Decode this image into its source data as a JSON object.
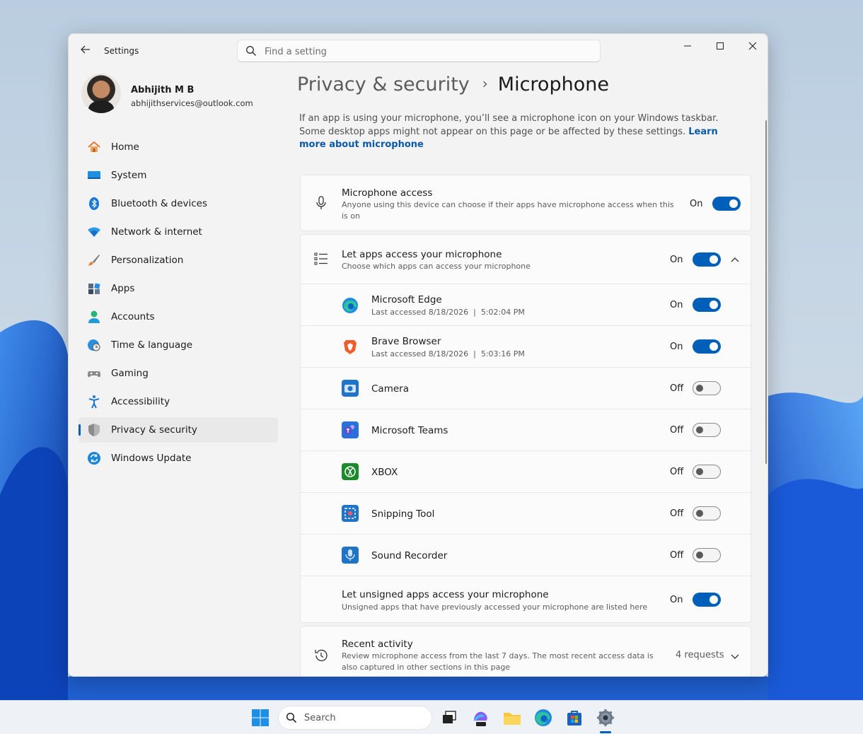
{
  "window": {
    "app_title": "Settings"
  },
  "search": {
    "placeholder": "Find a setting"
  },
  "profile": {
    "name": "Abhijith M B",
    "email": "abhijithservices@outlook.com"
  },
  "sidebar": {
    "items": [
      {
        "label": "Home",
        "icon": "home-icon"
      },
      {
        "label": "System",
        "icon": "system-icon"
      },
      {
        "label": "Bluetooth & devices",
        "icon": "bluetooth-icon"
      },
      {
        "label": "Network & internet",
        "icon": "wifi-icon"
      },
      {
        "label": "Personalization",
        "icon": "brush-icon"
      },
      {
        "label": "Apps",
        "icon": "apps-icon"
      },
      {
        "label": "Accounts",
        "icon": "accounts-icon"
      },
      {
        "label": "Time & language",
        "icon": "globe-clock-icon"
      },
      {
        "label": "Gaming",
        "icon": "controller-icon"
      },
      {
        "label": "Accessibility",
        "icon": "accessibility-icon"
      },
      {
        "label": "Privacy & security",
        "icon": "shield-icon",
        "active": true
      },
      {
        "label": "Windows Update",
        "icon": "refresh-icon"
      }
    ]
  },
  "header": {
    "parent": "Privacy & security",
    "separator": "›",
    "current": "Microphone"
  },
  "description": {
    "text": "If an app is using your microphone, you’ll see a microphone icon on your Windows taskbar. Some desktop apps might not appear on this page or be affected by these settings. ",
    "link": "Learn more about microphone"
  },
  "mic_access": {
    "title": "Microphone access",
    "subtitle": "Anyone using this device can choose if their apps have microphone access when this is on",
    "state": "On"
  },
  "apps_access": {
    "title": "Let apps access your microphone",
    "subtitle": "Choose which apps can access your microphone",
    "state": "On",
    "apps": [
      {
        "name": "Microsoft Edge",
        "sub": "Last accessed 8/18/2026  |  5:02:04 PM",
        "state": "On",
        "icon": "edge-icon"
      },
      {
        "name": "Brave Browser",
        "sub": "Last accessed 8/18/2026  |  5:03:16 PM",
        "state": "On",
        "icon": "brave-icon"
      },
      {
        "name": "Camera",
        "sub": "",
        "state": "Off",
        "icon": "camera-icon"
      },
      {
        "name": "Microsoft Teams",
        "sub": "",
        "state": "Off",
        "icon": "teams-icon"
      },
      {
        "name": "XBOX",
        "sub": "",
        "state": "Off",
        "icon": "xbox-icon"
      },
      {
        "name": "Snipping Tool",
        "sub": "",
        "state": "Off",
        "icon": "snipping-tool-icon"
      },
      {
        "name": "Sound Recorder",
        "sub": "",
        "state": "Off",
        "icon": "sound-recorder-icon"
      }
    ],
    "unsigned": {
      "title": "Let unsigned apps access your microphone",
      "subtitle": "Unsigned apps that have previously accessed your microphone are listed here",
      "state": "On"
    }
  },
  "recent": {
    "title": "Recent activity",
    "subtitle": "Review microphone access from the last 7 days. The most recent access data is also captured in other sections in this page",
    "count": "4 requests"
  },
  "taskbar": {
    "search_label": "Search"
  },
  "colors": {
    "accent": "#005fb8",
    "link": "#0a5aa8"
  }
}
